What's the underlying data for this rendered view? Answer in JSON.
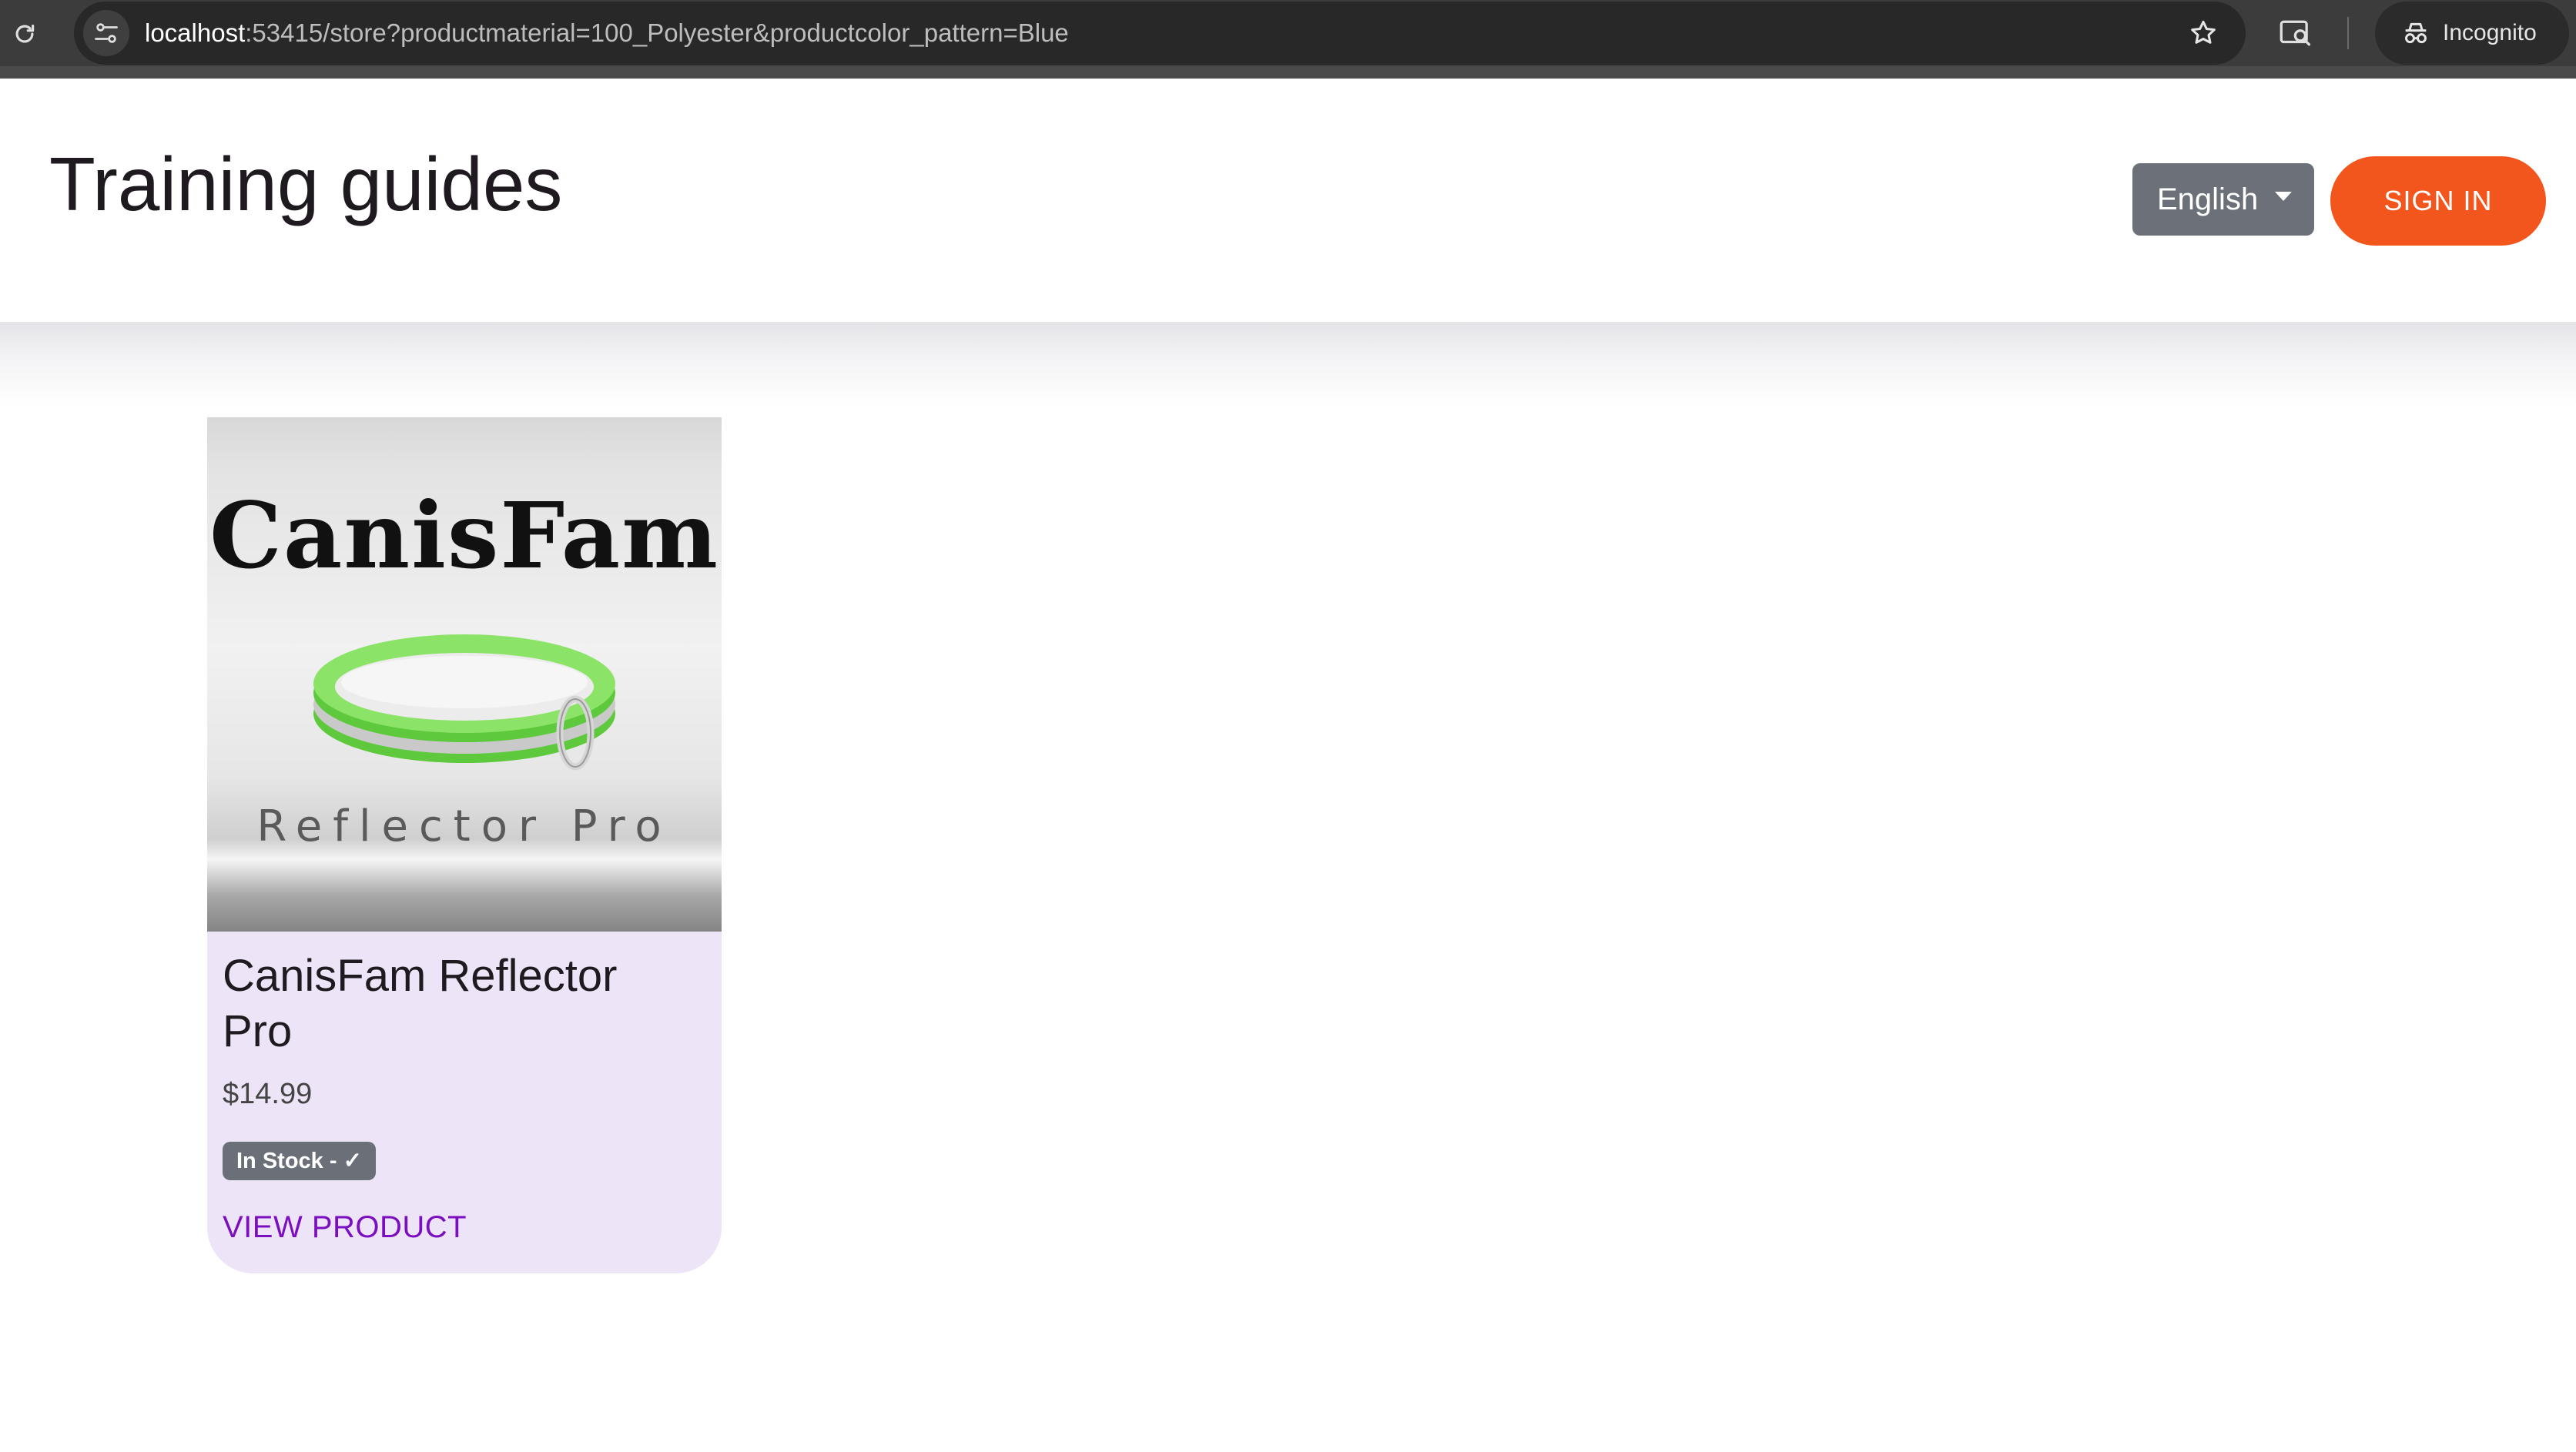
{
  "browser": {
    "url_host": "localhost",
    "url_rest": ":53415/store?productmaterial=100_Polyester&productcolor_pattern=Blue",
    "profile_label": "Incognito",
    "icons": [
      "reload-icon",
      "site-info-icon",
      "bookmark-star-icon",
      "search-tabs-icon",
      "incognito-icon"
    ]
  },
  "header": {
    "title": "Training guides",
    "language": "English",
    "sign_in": "SIGN IN"
  },
  "product": {
    "image_brand_text": "CanisFam",
    "image_product_text": "Reflector Pro",
    "name": "CanisFam Reflector Pro",
    "price": "$14.99",
    "stock": "In Stock - ✓",
    "link_label": "VIEW PRODUCT"
  },
  "colors": {
    "accent": "#f2561d",
    "link": "#7b0fc0",
    "card_background": "#ede4f7",
    "select_background": "#6b7079",
    "collar_green": "#7fe05a"
  }
}
